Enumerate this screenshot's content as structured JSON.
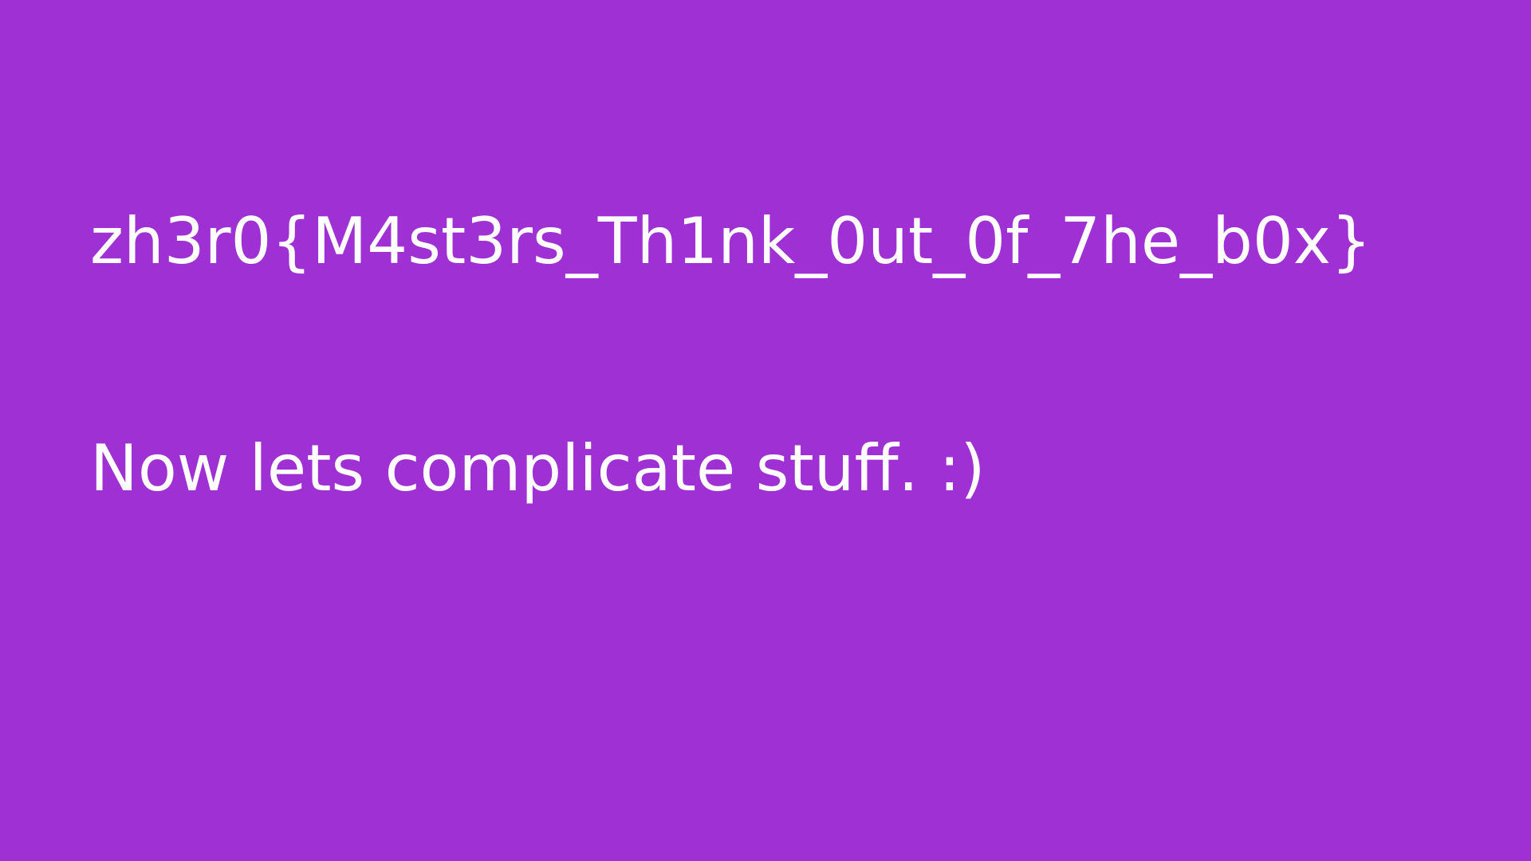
{
  "slide": {
    "background_color": "#9f30d4",
    "text_color": "#ffffff",
    "flag_text": "zh3r0{M4st3rs_Th1nk_0ut_0f_7he_b0x}",
    "message_text": "Now lets complicate stuff. :)"
  }
}
